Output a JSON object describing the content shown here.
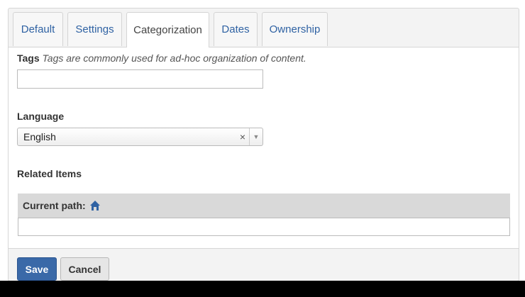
{
  "tabs": [
    {
      "label": "Default"
    },
    {
      "label": "Settings"
    },
    {
      "label": "Categorization"
    },
    {
      "label": "Dates"
    },
    {
      "label": "Ownership"
    }
  ],
  "tags": {
    "label": "Tags",
    "help": "Tags are commonly used for ad-hoc organization of content.",
    "value": ""
  },
  "language": {
    "label": "Language",
    "selected": "English",
    "clear_glyph": "×",
    "arrow_glyph": "▼"
  },
  "related_items": {
    "label": "Related Items",
    "current_path_label": "Current path:",
    "search_value": ""
  },
  "actions": {
    "save_label": "Save",
    "cancel_label": "Cancel"
  },
  "colors": {
    "primary": "#3a69a8",
    "link": "#2f62a3"
  }
}
